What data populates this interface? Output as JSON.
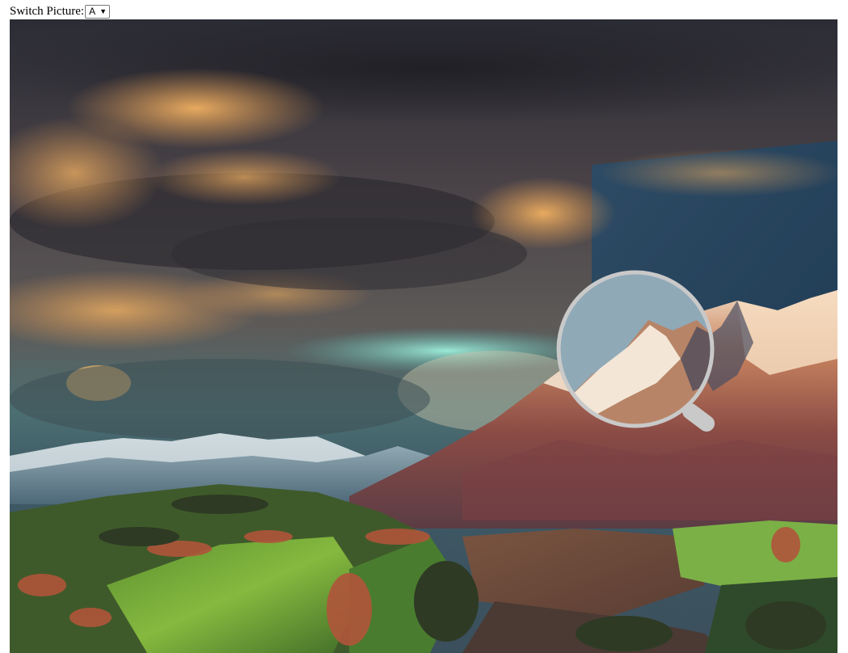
{
  "controls": {
    "label": "Switch Picture:",
    "selected_option": "A",
    "caret": "▼"
  },
  "photo": {
    "subject": "mountain landscape under stormy sunset clouds",
    "colors": {
      "storm_dark": "#2d2c34",
      "cloud_glow": "#e49a52",
      "sky_teal": "#7fd2c6",
      "sky_blue": "#1f4e73",
      "peak_snow": "#f4e3cf",
      "slope_rust": "#9c5042",
      "field_green": "#6fa83b"
    }
  },
  "magnifier": {
    "icon": "magnifier-lens-icon",
    "ring_color": "#c9c9c9"
  }
}
